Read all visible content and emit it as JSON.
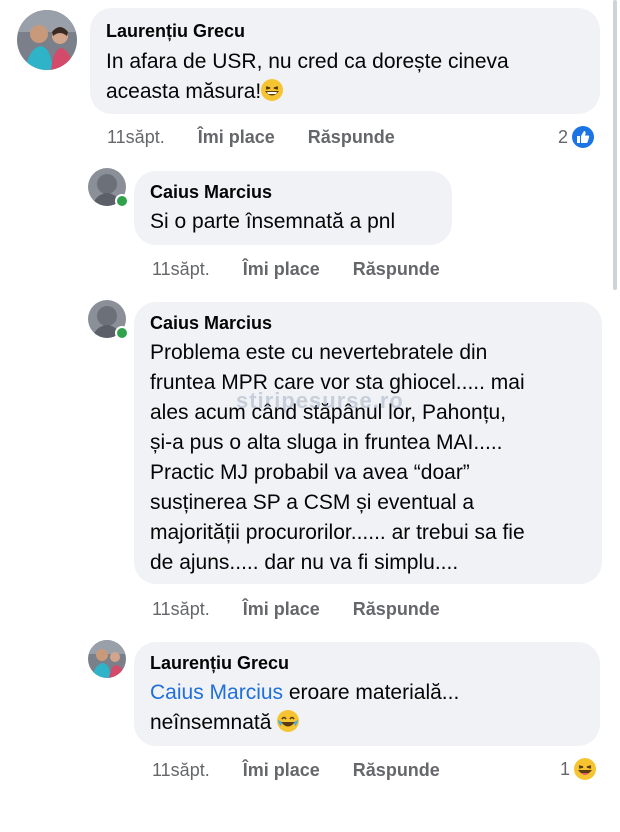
{
  "watermark": "stiripesurse.ro",
  "comments": [
    {
      "author": "Laurențiu Grecu",
      "lines": [
        "In afara de USR, nu cred ca dorește cineva",
        "aceasta măsura!"
      ],
      "emoji": "grinning-squinting-face",
      "time": "11săpt.",
      "like_label": "Îmi place",
      "reply_label": "Răspunde",
      "reaction_count": "2",
      "reaction_icon": "like-icon"
    },
    {
      "author": "Caius Marcius",
      "lines": [
        "Si o parte însemnată a pnl"
      ],
      "time": "11săpt.",
      "like_label": "Îmi place",
      "reply_label": "Răspunde",
      "online": true
    },
    {
      "author": "Caius Marcius",
      "lines": [
        "Problema este cu nevertebratele din",
        "fruntea MPR care vor sta ghiocel..... mai",
        "ales acum când stăpânul lor, Pahonțu,",
        "și-a pus o alta sluga in fruntea MAI.....",
        "Practic MJ probabil va avea “doar”",
        "susținerea SP a CSM  și eventual a",
        "majorității procurorilor...... ar trebui sa fie",
        "de ajuns..... dar nu va fi simplu...."
      ],
      "time": "11săpt.",
      "like_label": "Îmi place",
      "reply_label": "Răspunde",
      "online": true
    },
    {
      "author": "Laurențiu Grecu",
      "mention": "Caius Marcius",
      "line1_rest": " eroare materială...",
      "line2": "neînsemnată",
      "emoji": "face-with-tears-of-joy",
      "time": "11săpt.",
      "like_label": "Îmi place",
      "reply_label": "Răspunde",
      "reaction_count": "1",
      "reaction_icon": "haha-icon"
    }
  ],
  "colors": {
    "bubble": "#f0f2f5",
    "link": "#216fdb",
    "meta": "#65676b",
    "like_blue": "#1b74e4",
    "haha_yellow": "#f7c431",
    "online_green": "#31a24c"
  }
}
